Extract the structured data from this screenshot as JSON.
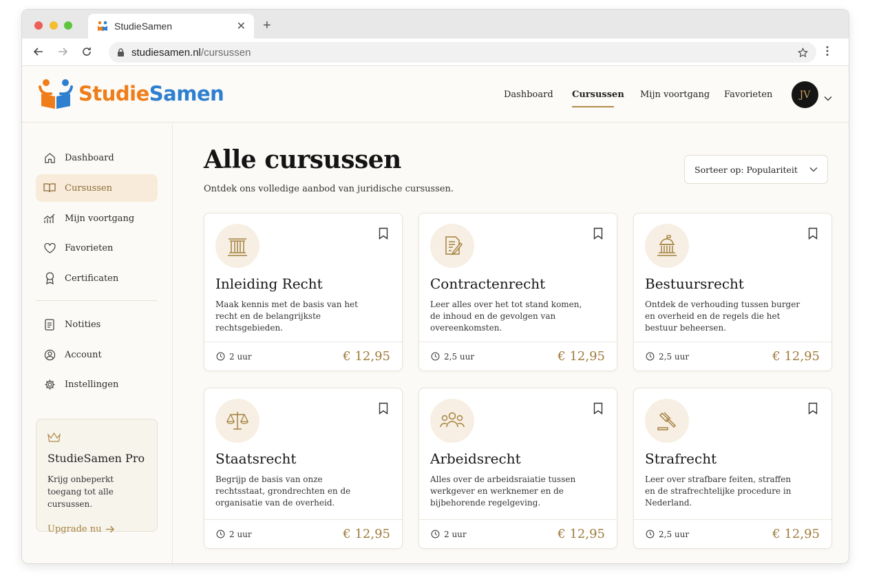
{
  "browser": {
    "tab_title": "StudieSamen",
    "url_domain": "studiesamen.nl",
    "url_path": "/cursussen"
  },
  "header": {
    "logo_part1": "Studie",
    "logo_part2": "Samen",
    "nav": [
      {
        "label": "Dashboard"
      },
      {
        "label": "Cursussen"
      },
      {
        "label": "Mijn voortgang"
      },
      {
        "label": "Favorieten"
      }
    ],
    "avatar_initials": "JV"
  },
  "sidebar": {
    "items": [
      {
        "label": "Dashboard",
        "icon": "home-icon"
      },
      {
        "label": "Cursussen",
        "icon": "book-icon"
      },
      {
        "label": "Mijn voortgang",
        "icon": "chart-icon"
      },
      {
        "label": "Favorieten",
        "icon": "heart-icon"
      },
      {
        "label": "Certificaten",
        "icon": "award-icon"
      }
    ],
    "items2": [
      {
        "label": "Notities",
        "icon": "note-icon"
      },
      {
        "label": "Account",
        "icon": "user-icon"
      },
      {
        "label": "Instellingen",
        "icon": "gear-icon"
      }
    ],
    "pro": {
      "title": "StudieSamen Pro",
      "text": "Krijg onbeperkt toegang tot alle cursussen.",
      "link": "Upgrade nu"
    }
  },
  "main": {
    "title": "Alle cursussen",
    "subtitle": "Ontdek ons volledige aanbod van juridische cursussen.",
    "sort_label": "Sorteer op: Populariteit",
    "courses": [
      {
        "title": "Inleiding Recht",
        "desc": "Maak kennis met de basis van het recht en de belangrijkste rechtsgebieden.",
        "duration": "2 uur",
        "price": "€ 12,95",
        "icon": "pillar-icon"
      },
      {
        "title": "Contractenrecht",
        "desc": "Leer alles over het tot stand komen, de inhoud en de gevolgen van overeenkomsten.",
        "duration": "2,5 uur",
        "price": "€ 12,95",
        "icon": "contract-icon"
      },
      {
        "title": "Bestuursrecht",
        "desc": "Ontdek de verhouding tussen burger en overheid en de regels die het bestuur beheersen.",
        "duration": "2,5 uur",
        "price": "€ 12,95",
        "icon": "government-building-icon"
      },
      {
        "title": "Staatsrecht",
        "desc": "Begrijp de basis van onze rechtsstaat, grondrechten en de organisatie van de overheid.",
        "duration": "2 uur",
        "price": "€ 12,95",
        "icon": "scales-icon"
      },
      {
        "title": "Arbeidsrecht",
        "desc": "Alles over de arbeidsraiatie tussen werkgever en werknemer en de bijbehorende regelgeving.",
        "duration": "2 uur",
        "price": "€ 12,95",
        "icon": "people-icon"
      },
      {
        "title": "Strafrecht",
        "desc": "Leer over strafbare feiten, straffen en de strafrechtelijke procedure in Nederland.",
        "duration": "2,5 uur",
        "price": "€ 12,95",
        "icon": "gavel-icon"
      }
    ]
  },
  "colors": {
    "accent": "#a4813f",
    "active_bg": "#f8ebda",
    "logo_orange": "#ef7d1a",
    "logo_blue": "#2f7fd0"
  }
}
